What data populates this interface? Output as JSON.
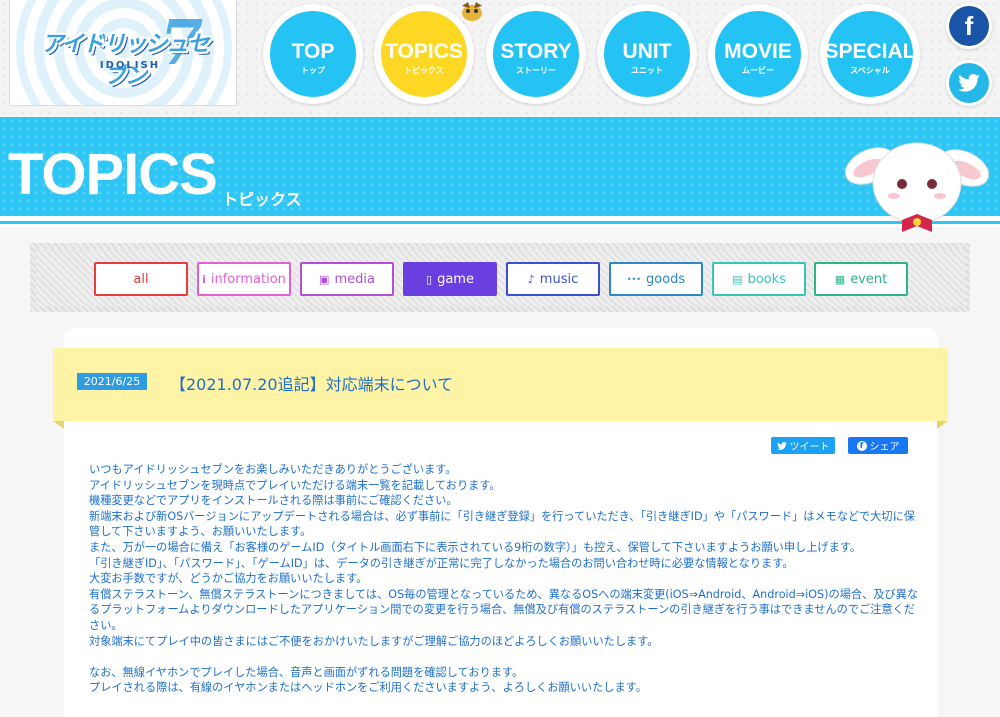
{
  "logo": {
    "text": "アイドリッシュセブン",
    "sub": "IDOLISH",
    "seven": "7"
  },
  "nav": [
    {
      "label": "TOP",
      "sub": "トップ",
      "active": false
    },
    {
      "label": "TOPICS",
      "sub": "トピックス",
      "active": true
    },
    {
      "label": "STORY",
      "sub": "ストーリー",
      "active": false
    },
    {
      "label": "UNIT",
      "sub": "ユニット",
      "active": false
    },
    {
      "label": "MOVIE",
      "sub": "ムービー",
      "active": false
    },
    {
      "label": "SPECIAL",
      "sub": "スペシャル",
      "active": false
    }
  ],
  "social": {
    "facebook": "f",
    "twitter": "twitter-bird"
  },
  "banner": {
    "title": "TOPICS",
    "sub": "トピックス"
  },
  "filters": [
    {
      "label": "all",
      "icon": "",
      "color": "#e83b3b",
      "active": false
    },
    {
      "label": "information",
      "icon": "i",
      "color": "#e35fd4",
      "active": false
    },
    {
      "label": "media",
      "icon": "▣",
      "color": "#b24fd6",
      "active": false
    },
    {
      "label": "game",
      "icon": "▯",
      "color": "#6a3fe0",
      "active": true
    },
    {
      "label": "music",
      "icon": "♪",
      "color": "#3b4fd6",
      "active": false
    },
    {
      "label": "goods",
      "icon": "•••",
      "color": "#2f86c9",
      "active": false
    },
    {
      "label": "books",
      "icon": "▤",
      "color": "#3cc3b8",
      "active": false
    },
    {
      "label": "event",
      "icon": "▦",
      "color": "#2fb38a",
      "active": false
    }
  ],
  "post": {
    "date": "2021/6/25",
    "title": "【2021.07.20追記】対応端末について",
    "tweet": "ツイート",
    "share": "シェア",
    "lines": [
      "いつもアイドリッシュセブンをお楽しみいただきありがとうございます。",
      "アイドリッシュセブンを現時点でプレイいただける端末一覧を記載しております。",
      "機種変更などでアプリをインストールされる際は事前にご確認ください。",
      "新端末および新OSバージョンにアップデートされる場合は、必ず事前に「引き継ぎ登録」を行っていただき、「引き継ぎID」や「パスワード」はメモなどで大切に保管して下さいますよう、お願いいたします。",
      "また、万が一の場合に備え「お客様のゲームID（タイトル画面右下に表示されている9桁の数字）」も控え、保管して下さいますようお願い申し上げます。",
      "「引き継ぎID」、「パスワード」、「ゲームID」は、データの引き継ぎが正常に完了しなかった場合のお問い合わせ時に必要な情報となります。",
      "大変お手数ですが、どうかご協力をお願いいたします。",
      "有償ステラストーン、無償ステラストーンにつきましては、OS毎の管理となっているため、異なるOSへの端末変更(iOS⇒Android、Android⇒iOS)の場合、及び異なるプラットフォームよりダウンロードしたアプリケーション間での変更を行う場合、無償及び有償のステラストーンの引き継ぎを行う事はできませんのでご注意ください。",
      "対象端末にてプレイ中の皆さまにはご不便をおかけいたしますがご理解ご協力のほどよろしくお願いいたします。",
      "",
      "なお、無線イヤホンでプレイした場合、音声と画面がずれる問題を確認しております。",
      "プレイされる際は、有線のイヤホンまたはヘッドホンをご利用くださいますよう、よろしくお願いいたします。"
    ]
  }
}
